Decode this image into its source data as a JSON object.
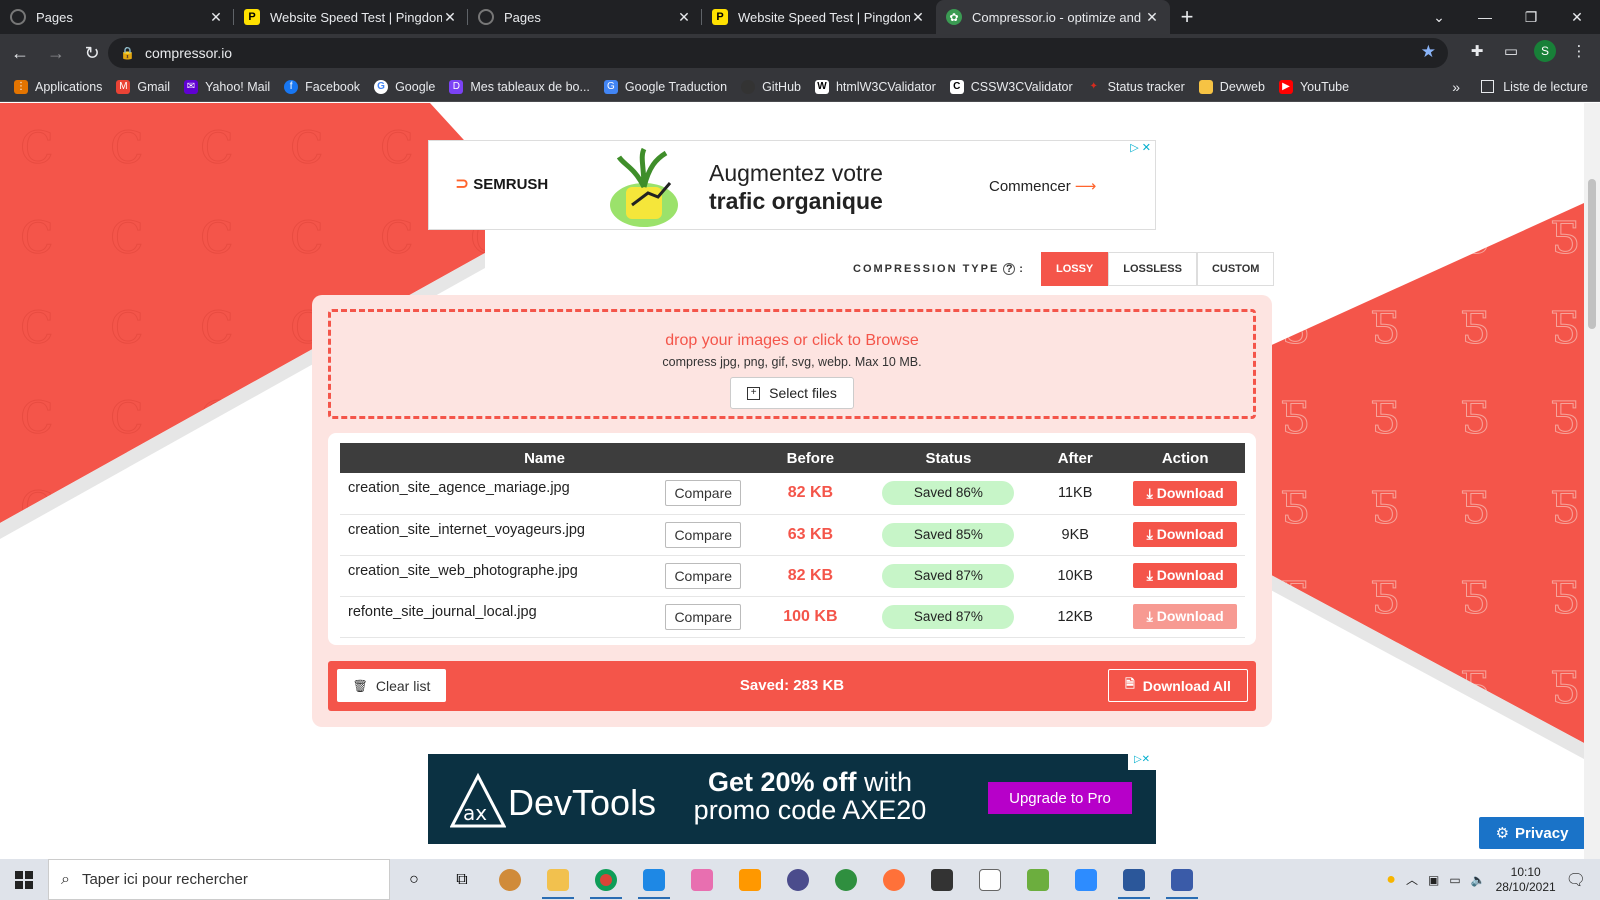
{
  "browser": {
    "tabs": [
      {
        "title": "Pages",
        "favicon": "github-icon",
        "active": false
      },
      {
        "title": "Website Speed Test | Pingdom To",
        "favicon": "pingdom-icon",
        "active": false
      },
      {
        "title": "Pages",
        "favicon": "github-icon",
        "active": false
      },
      {
        "title": "Website Speed Test | Pingdom To",
        "favicon": "pingdom-icon",
        "active": false
      },
      {
        "title": "Compressor.io - optimize and co",
        "favicon": "compressor-icon",
        "active": true
      }
    ],
    "url": "compressor.io",
    "profile_initial": "S",
    "bookmarks": [
      {
        "label": "Applications",
        "icon": "apps-grid-icon",
        "color": "#e37400"
      },
      {
        "label": "Gmail",
        "icon": "gmail-icon",
        "color": "#ea4335"
      },
      {
        "label": "Yahoo! Mail",
        "icon": "yahoo-icon",
        "color": "#6001d2"
      },
      {
        "label": "Facebook",
        "icon": "facebook-icon",
        "color": "#1877f2"
      },
      {
        "label": "Google",
        "icon": "google-icon",
        "color": "#4285f4"
      },
      {
        "label": "Mes tableaux de bo...",
        "icon": "dashboard-icon",
        "color": "#7b42f5"
      },
      {
        "label": "Google Traduction",
        "icon": "translate-icon",
        "color": "#4285f4"
      },
      {
        "label": "GitHub",
        "icon": "github-icon",
        "color": "#333333"
      },
      {
        "label": "htmlW3CValidator",
        "icon": "w3c-icon",
        "color": "#ffffff"
      },
      {
        "label": "CSSW3CValidator",
        "icon": "w3c-css-icon",
        "color": "#ffffff"
      },
      {
        "label": "Status tracker",
        "icon": "maple-leaf-icon",
        "color": "#d52b1e"
      },
      {
        "label": "Devweb",
        "icon": "folder-icon",
        "color": "#f6c344"
      },
      {
        "label": "YouTube",
        "icon": "youtube-icon",
        "color": "#ff0000"
      }
    ],
    "more": "»",
    "reading_list": "Liste de lecture"
  },
  "ad_top": {
    "brand": "SEMRUSH",
    "headline_line1": "Augmentez votre",
    "headline_line2": "trafic organique",
    "cta": "Commencer"
  },
  "compression": {
    "label": "COMPRESSION TYPE",
    "options": [
      {
        "label": "LOSSY",
        "selected": true
      },
      {
        "label": "LOSSLESS",
        "selected": false
      },
      {
        "label": "CUSTOM",
        "selected": false
      }
    ]
  },
  "dropzone": {
    "title": "drop your images or click to Browse",
    "subtitle": "compress jpg, png, gif, svg, webp. Max 10 MB.",
    "select_button": "Select files"
  },
  "table": {
    "headers": [
      "Name",
      "Before",
      "Status",
      "After",
      "Action"
    ],
    "compare_label": "Compare",
    "download_label": "Download",
    "rows": [
      {
        "name": "creation_site_agence_mariage.jpg",
        "before": "82 KB",
        "status": "Saved 86%",
        "after": "11KB"
      },
      {
        "name": "creation_site_internet_voyageurs.jpg",
        "before": "63 KB",
        "status": "Saved 85%",
        "after": "9KB"
      },
      {
        "name": "creation_site_web_photographe.jpg",
        "before": "82 KB",
        "status": "Saved 87%",
        "after": "10KB"
      },
      {
        "name": "refonte_site_journal_local.jpg",
        "before": "100 KB",
        "status": "Saved 87%",
        "after": "12KB"
      }
    ]
  },
  "summary": {
    "clear_list": "Clear list",
    "saved_total": "Saved: 283 KB",
    "download_all": "Download All"
  },
  "ad_bottom": {
    "brand": "DevTools",
    "logo_text": "ax",
    "promo_bold": "Get 20% off",
    "promo_rest": " with",
    "promo_line2": "promo code AXE20",
    "cta": "Upgrade to Pro"
  },
  "privacy_button": "Privacy",
  "taskbar": {
    "search_placeholder": "Taper ici pour rechercher",
    "time": "10:10",
    "date": "28/10/2021"
  }
}
